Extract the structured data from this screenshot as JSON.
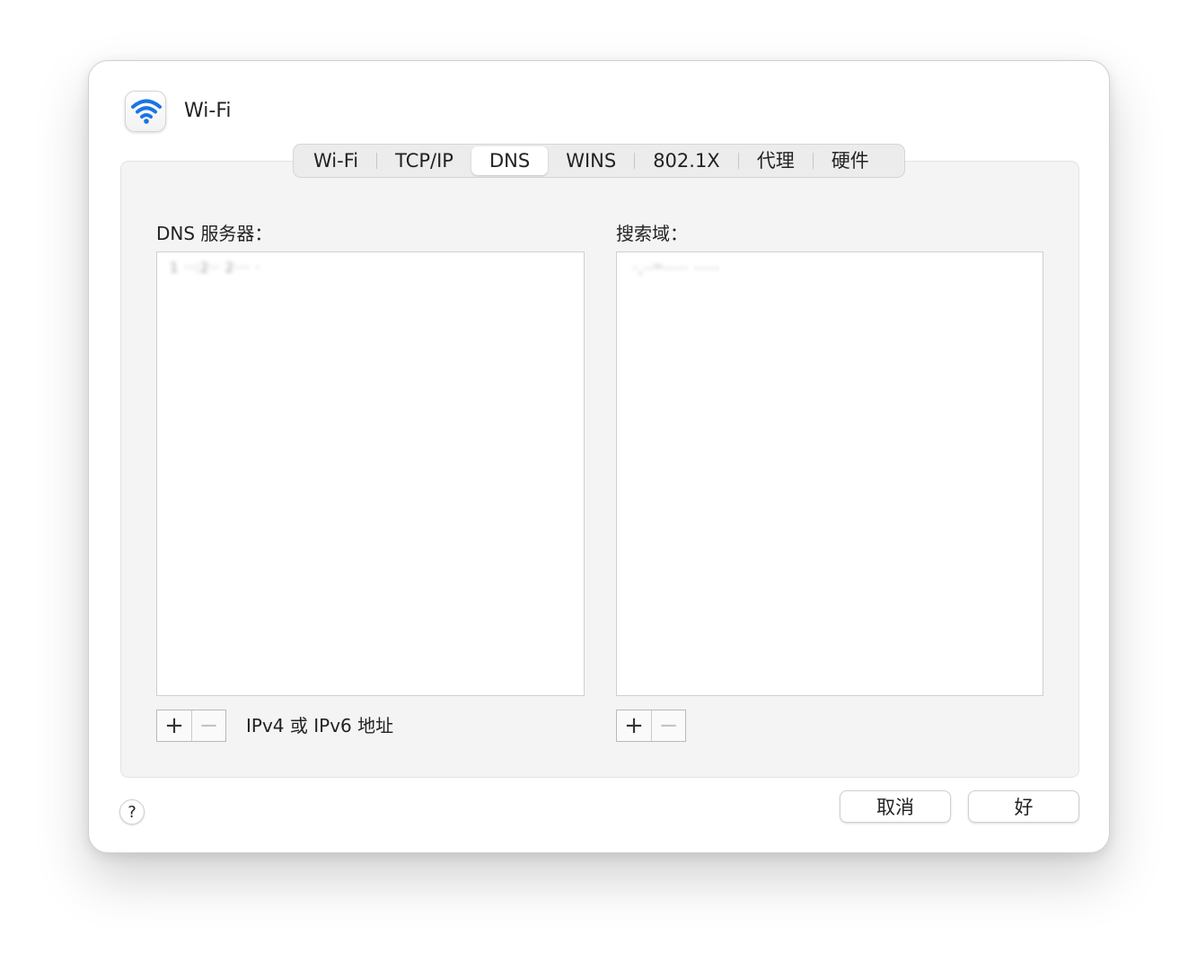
{
  "window": {
    "title": "Wi-Fi",
    "icon": "wifi-icon",
    "accent_color": "#1a73e8"
  },
  "tabs": [
    {
      "label": "Wi-Fi",
      "active": false
    },
    {
      "label": "TCP/IP",
      "active": false
    },
    {
      "label": "DNS",
      "active": true
    },
    {
      "label": "WINS",
      "active": false
    },
    {
      "label": "802.1X",
      "active": false
    },
    {
      "label": "代理",
      "active": false
    },
    {
      "label": "硬件",
      "active": false
    }
  ],
  "dns_servers": {
    "label": "DNS 服务器：",
    "entries": [
      "1 ··:2··  2··· ·"
    ],
    "add_label": "+",
    "remove_label": "−",
    "hint": "IPv4 或 IPv6 地址"
  },
  "search_domains": {
    "label": "搜索域：",
    "entries": [
      "·,··ᵐ·····  ·····"
    ],
    "add_label": "+",
    "remove_label": "−"
  },
  "footer": {
    "help_label": "?",
    "cancel_label": "取消",
    "ok_label": "好"
  }
}
